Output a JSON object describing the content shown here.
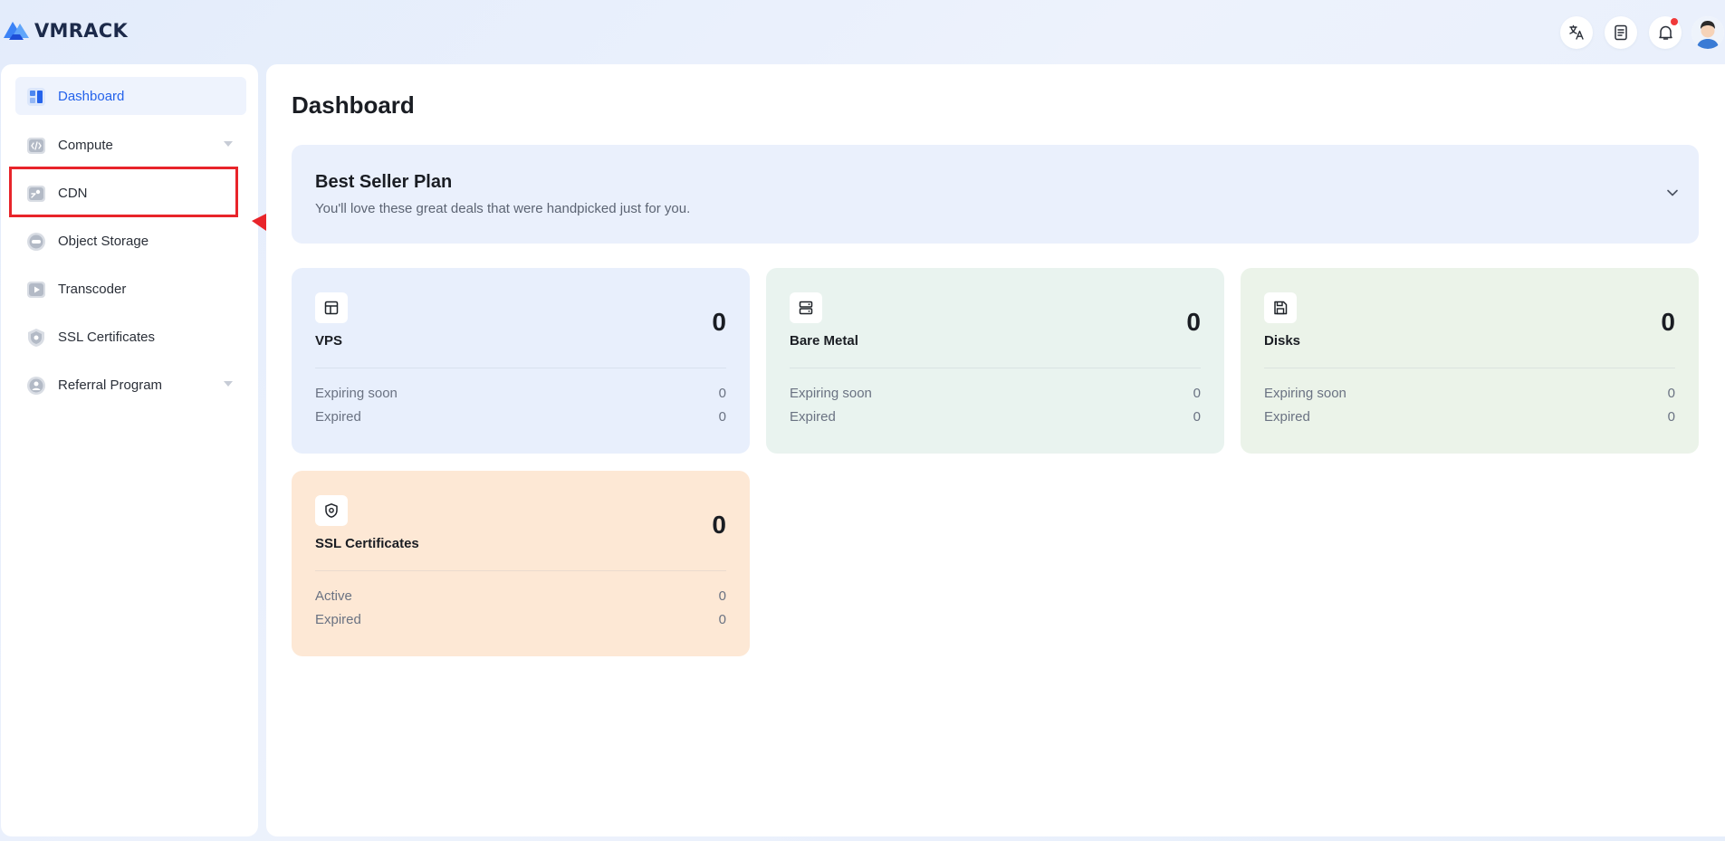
{
  "header": {
    "logo_text": "VMRACK",
    "icons": [
      "translate-icon",
      "document-icon",
      "bell-icon",
      "user-avatar"
    ],
    "notification_dot_color": "#f03a3a"
  },
  "sidebar": {
    "items": [
      {
        "label": "Dashboard",
        "icon": "dashboard-icon",
        "active": true,
        "has_caret": false
      },
      {
        "label": "Compute",
        "icon": "compute-icon",
        "active": false,
        "has_caret": true
      },
      {
        "label": "CDN",
        "icon": "cdn-icon",
        "active": false,
        "has_caret": false
      },
      {
        "label": "Object Storage",
        "icon": "object-storage-icon",
        "active": false,
        "has_caret": false
      },
      {
        "label": "Transcoder",
        "icon": "transcoder-icon",
        "active": false,
        "has_caret": false
      },
      {
        "label": "SSL Certificates",
        "icon": "ssl-certificates-icon",
        "active": false,
        "has_caret": false
      },
      {
        "label": "Referral Program",
        "icon": "referral-icon",
        "active": false,
        "has_caret": true
      }
    ],
    "accent_color": "#2563eb"
  },
  "annotation": {
    "highlight_color": "#e8242a",
    "highlighted_item": "CDN"
  },
  "main": {
    "title": "Dashboard",
    "plan": {
      "title": "Best Seller Plan",
      "subtitle": "You'll love these great deals that were handpicked just for you."
    },
    "cards": [
      {
        "title": "VPS",
        "count": "0",
        "icon": "vps-icon",
        "rows": [
          {
            "label": "Expiring soon",
            "value": "0"
          },
          {
            "label": "Expired",
            "value": "0"
          }
        ]
      },
      {
        "title": "Bare Metal",
        "count": "0",
        "icon": "server-icon",
        "rows": [
          {
            "label": "Expiring soon",
            "value": "0"
          },
          {
            "label": "Expired",
            "value": "0"
          }
        ]
      },
      {
        "title": "Disks",
        "count": "0",
        "icon": "disk-icon",
        "rows": [
          {
            "label": "Expiring soon",
            "value": "0"
          },
          {
            "label": "Expired",
            "value": "0"
          }
        ]
      },
      {
        "title": "SSL Certificates",
        "count": "0",
        "icon": "shield-icon",
        "rows": [
          {
            "label": "Active",
            "value": "0"
          },
          {
            "label": "Expired",
            "value": "0"
          }
        ]
      }
    ]
  }
}
